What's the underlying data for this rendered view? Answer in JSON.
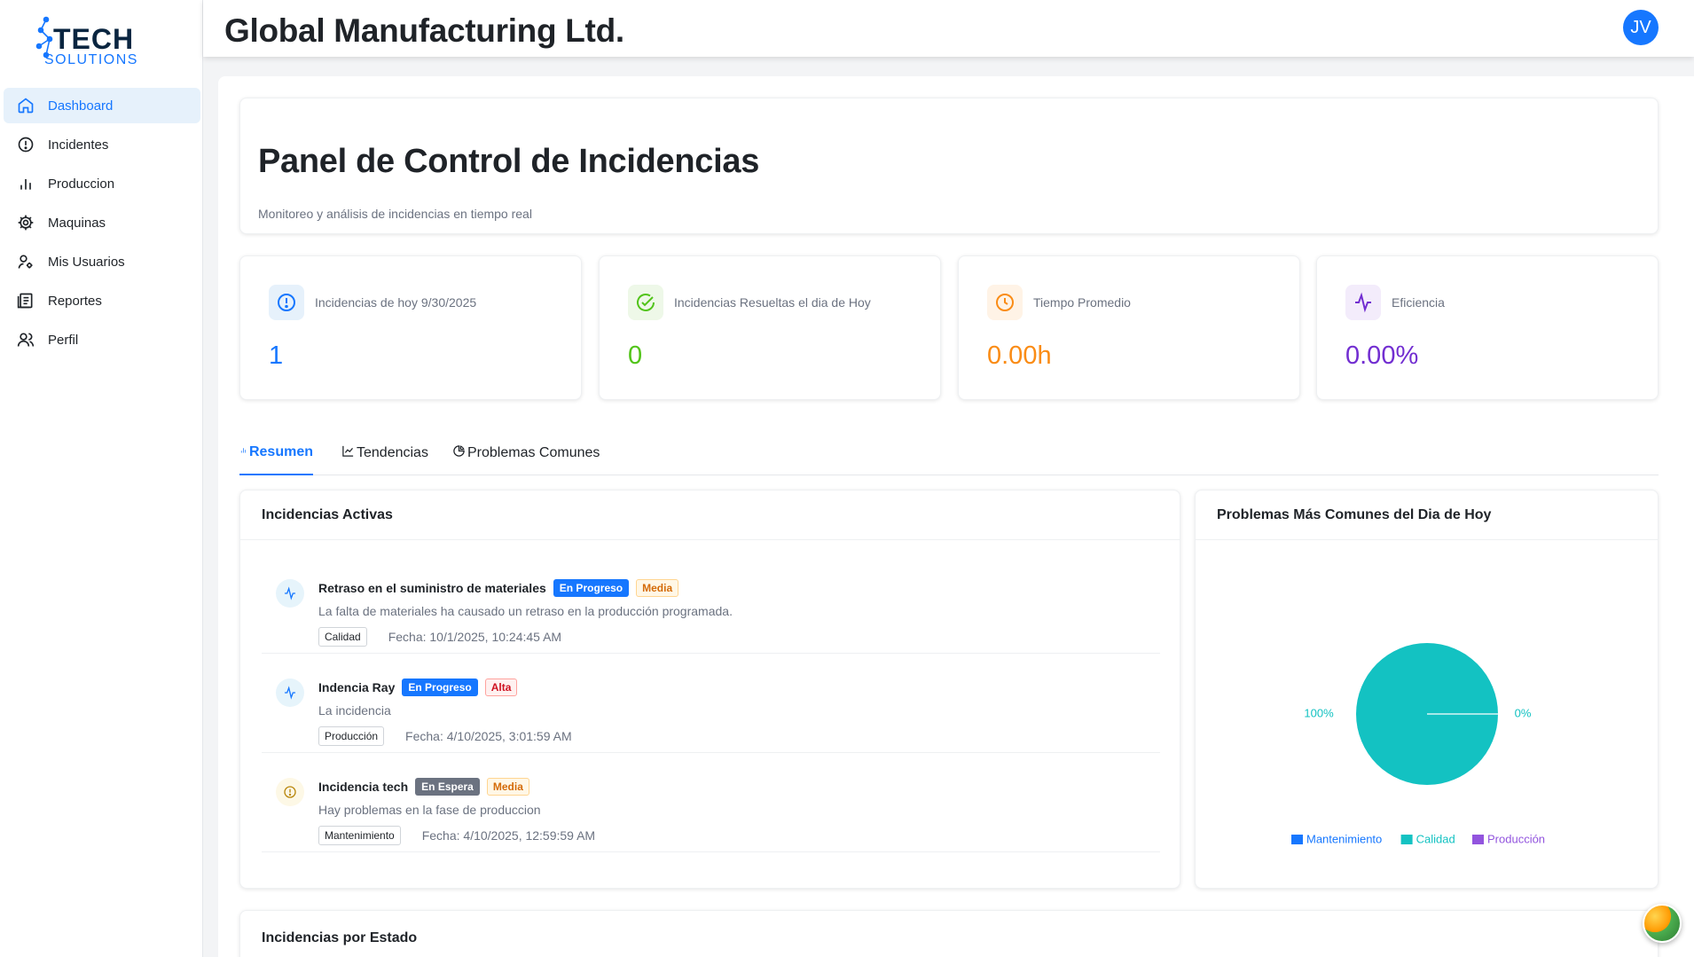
{
  "logo": {
    "line1": "TECH",
    "line2": "SOLUTIONS"
  },
  "sidebar": {
    "items": [
      {
        "label": "Dashboard",
        "icon": "home-icon",
        "active": true
      },
      {
        "label": "Incidentes",
        "icon": "alert-circle-icon"
      },
      {
        "label": "Produccion",
        "icon": "bar-chart-icon"
      },
      {
        "label": "Maquinas",
        "icon": "gear-icon"
      },
      {
        "label": "Mis Usuarios",
        "icon": "user-settings-icon"
      },
      {
        "label": "Reportes",
        "icon": "report-icon"
      },
      {
        "label": "Perfil",
        "icon": "users-icon"
      }
    ]
  },
  "header": {
    "company": "Global Manufacturing Ltd.",
    "avatar_initials": "JV"
  },
  "panel": {
    "title": "Panel de Control de Incidencias",
    "subtitle": "Monitoreo y análisis de incidencias en tiempo real"
  },
  "stats": [
    {
      "label": "Incidencias de hoy 9/30/2025",
      "value": "1",
      "color": "#1677ff",
      "icon": "alert-circle-icon"
    },
    {
      "label": "Incidencias Resueltas el dia de Hoy",
      "value": "0",
      "color": "#52c41a",
      "icon": "check-circle-icon"
    },
    {
      "label": "Tiempo Promedio",
      "value": "0.00h",
      "color": "#fa8c16",
      "icon": "clock-icon"
    },
    {
      "label": "Eficiencia",
      "value": "0.00%",
      "color": "#722ed1",
      "icon": "activity-icon"
    }
  ],
  "tabs": [
    {
      "label": "Resumen",
      "icon": "bar-chart-icon",
      "active": true
    },
    {
      "label": "Tendencias",
      "icon": "line-chart-icon"
    },
    {
      "label": "Problemas Comunes",
      "icon": "pie-chart-icon"
    }
  ],
  "active_incidents": {
    "title": "Incidencias Activas",
    "items": [
      {
        "title": "Retraso en el suministro de materiales",
        "status": "En Progreso",
        "priority": "Media",
        "description": "La falta de materiales ha causado un retraso en la producción programada.",
        "category": "Calidad",
        "date": "Fecha: 10/1/2025, 10:24:45 AM",
        "icon": "activity-icon"
      },
      {
        "title": "Indencia Ray",
        "status": "En Progreso",
        "priority": "Alta",
        "description": "La incidencia",
        "category": "Producción",
        "date": "Fecha: 4/10/2025, 3:01:59 AM",
        "icon": "activity-icon"
      },
      {
        "title": "Incidencia tech",
        "status": "En Espera",
        "priority": "Media",
        "description": "Hay problemas en la fase de produccion",
        "category": "Mantenimiento",
        "date": "Fecha: 4/10/2025, 12:59:59 AM",
        "icon": "alert-circle-icon"
      }
    ]
  },
  "common_problems": {
    "title": "Problemas Más Comunes del Dia de Hoy"
  },
  "chart_data": {
    "type": "pie",
    "title": "Problemas Más Comunes del Dia de Hoy",
    "slices": [
      {
        "name": "Mantenimiento",
        "value": 0,
        "color": "#1677ff"
      },
      {
        "name": "Calidad",
        "value": 100,
        "color": "#13c2c2"
      },
      {
        "name": "Producción",
        "value": 0,
        "color": "#9254de"
      }
    ],
    "labels": [
      "100%",
      "0%"
    ],
    "legend_position": "bottom"
  },
  "state_section": {
    "title": "Incidencias por Estado"
  }
}
